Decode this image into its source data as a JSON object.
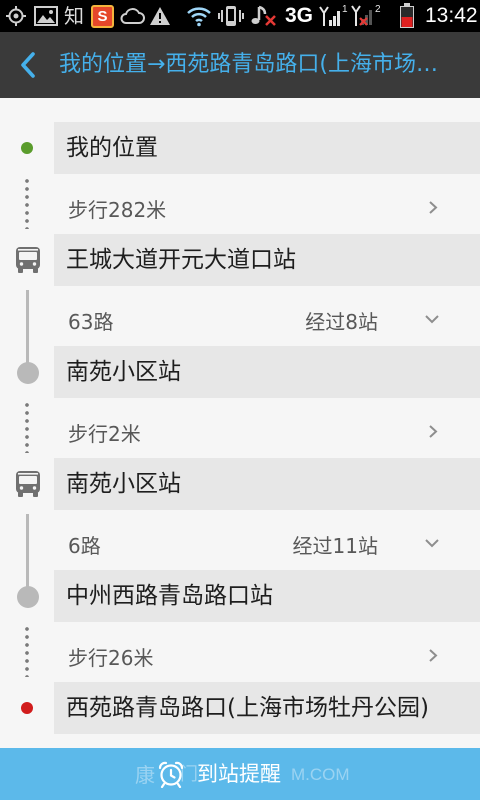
{
  "theme": {
    "status_bar_bg": "#000000",
    "header_bg": "#3a3a3a",
    "accent": "#45b0eb",
    "page_bg": "#f6f6f6",
    "station_row_bg": "#e7e7e7",
    "start_dot": "#5a9c2c",
    "end_dot": "#d11c1c",
    "connector": "#b9b9b9",
    "walk_dots": "#7a7a7a",
    "chevron": "#8e8e8e",
    "footer_bg": "#5cb9ea",
    "battery_low": "#e02020"
  },
  "status_bar": {
    "left_icons": [
      "gps-icon",
      "gallery-icon",
      "zhihu-icon",
      "sogou-icon",
      "cloud-icon",
      "warning-icon"
    ],
    "zhihu_glyph": "知",
    "sogou_logo_text": "S",
    "right_icons": [
      "wifi-icon",
      "vibrate-icon",
      "music-muted-icon",
      "signal-sim1-icon",
      "signal-sim2-icon",
      "battery-icon"
    ],
    "network_type": "3G",
    "sim1_label": "1",
    "sim2_label": "2",
    "battery_level": 0.5,
    "time": "13:42"
  },
  "header": {
    "back_icon": "chevron-left-icon",
    "title": "我的位置→西苑路青岛路口(上海市场…"
  },
  "route": {
    "items": [
      {
        "marker_icon": "origin-dot-icon",
        "name": "我的位置"
      },
      {
        "marker_icon": "walk-dots",
        "text": "步行282米",
        "action_icon": "chevron-right-icon"
      },
      {
        "marker_icon": "bus-icon",
        "name": "王城大道开元大道口站"
      },
      {
        "marker_icon": "bus-line",
        "line": "63路",
        "stops": "经过8站",
        "action_icon": "chevron-down-icon"
      },
      {
        "marker_icon": "stop-circle-icon",
        "name": "南苑小区站"
      },
      {
        "marker_icon": "walk-dots",
        "text": "步行2米",
        "action_icon": "chevron-right-icon"
      },
      {
        "marker_icon": "bus-icon",
        "name": "南苑小区站"
      },
      {
        "marker_icon": "bus-line",
        "line": "6路",
        "stops": "经过11站",
        "action_icon": "chevron-down-icon"
      },
      {
        "marker_icon": "stop-circle-icon",
        "name": "中州西路青岛路口站"
      },
      {
        "marker_icon": "walk-dots",
        "text": "步行26米",
        "action_icon": "chevron-right-icon"
      },
      {
        "marker_icon": "destination-dot-icon",
        "name": "西苑路青岛路口(上海市场牡丹公园)"
      }
    ]
  },
  "footer": {
    "icon": "alarm-clock-icon",
    "label": "到站提醒"
  },
  "watermark": {
    "left": "康",
    "middle": "门",
    "right": "M.COM"
  }
}
